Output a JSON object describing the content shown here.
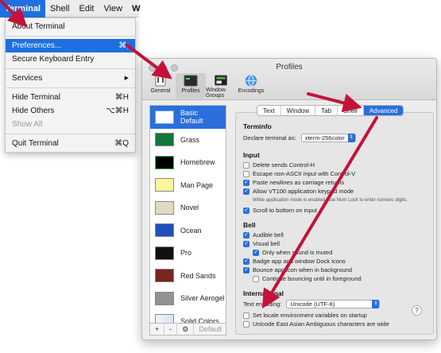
{
  "menubar": {
    "items": [
      "Terminal",
      "Shell",
      "Edit",
      "View",
      "W"
    ]
  },
  "menu": {
    "about": "About Terminal",
    "preferences": "Preferences...",
    "preferences_shortcut": "⌘,",
    "secure_keyboard": "Secure Keyboard Entry",
    "services": "Services",
    "services_arrow": "▶",
    "hide": "Hide Terminal",
    "hide_shortcut": "⌘H",
    "hide_others": "Hide Others",
    "hide_others_shortcut": "⌥⌘H",
    "show_all": "Show All",
    "quit": "Quit Terminal",
    "quit_shortcut": "⌘Q"
  },
  "window": {
    "title": "Profiles",
    "toolbar": [
      "General",
      "Profiles",
      "Window Groups",
      "Encodings"
    ]
  },
  "profiles": [
    {
      "name": "Basic",
      "sub": "Default"
    },
    {
      "name": "Grass"
    },
    {
      "name": "Homebrew"
    },
    {
      "name": "Man Page"
    },
    {
      "name": "Novel"
    },
    {
      "name": "Ocean"
    },
    {
      "name": "Pro"
    },
    {
      "name": "Red Sands"
    },
    {
      "name": "Silver Aerogel"
    },
    {
      "name": "Solid Colors"
    }
  ],
  "profile_footer": {
    "add": "+",
    "remove": "-",
    "gear": "⚙ ▾",
    "default": "Default"
  },
  "tabs": [
    "Text",
    "Window",
    "Tab",
    "Shell",
    "Advanced"
  ],
  "terminfo": {
    "heading": "Terminfo",
    "declare_label": "Declare terminal as:",
    "declare_value": "xterm-256color"
  },
  "input": {
    "heading": "Input",
    "items": [
      {
        "label": "Delete sends Control-H",
        "checked": false
      },
      {
        "label": "Escape non-ASCII input with Control-V",
        "checked": false
      },
      {
        "label": "Paste newlines as carriage returns",
        "checked": true
      },
      {
        "label": "Allow VT100 application keypad mode",
        "checked": true
      }
    ],
    "note": "While application mode is enabled, use Num Lock to enter numeric digits.",
    "scroll": {
      "label": "Scroll to bottom on input",
      "checked": true
    }
  },
  "bell": {
    "heading": "Bell",
    "audible": {
      "label": "Audible bell",
      "checked": true
    },
    "visual": {
      "label": "Visual bell",
      "checked": true
    },
    "only_muted": {
      "label": "Only when sound is muted",
      "checked": true
    },
    "badge": {
      "label": "Badge app and window Dock icons",
      "checked": true
    },
    "bounce": {
      "label": "Bounce app icon when in background",
      "checked": true
    },
    "continue": {
      "label": "Continue bouncing until in foreground",
      "checked": false
    }
  },
  "international": {
    "heading": "International",
    "encoding_label": "Text encoding:",
    "encoding_value": "Unicode (UTF-8)",
    "set_locale": {
      "label": "Set locale environment variables on startup",
      "checked": false
    },
    "east_asian": {
      "label": "Unicode East Asian Ambiguous characters are wide",
      "checked": false
    }
  },
  "help": "?",
  "colors": {
    "accent": "#2a6fdb",
    "arrow": "#c4123a"
  }
}
